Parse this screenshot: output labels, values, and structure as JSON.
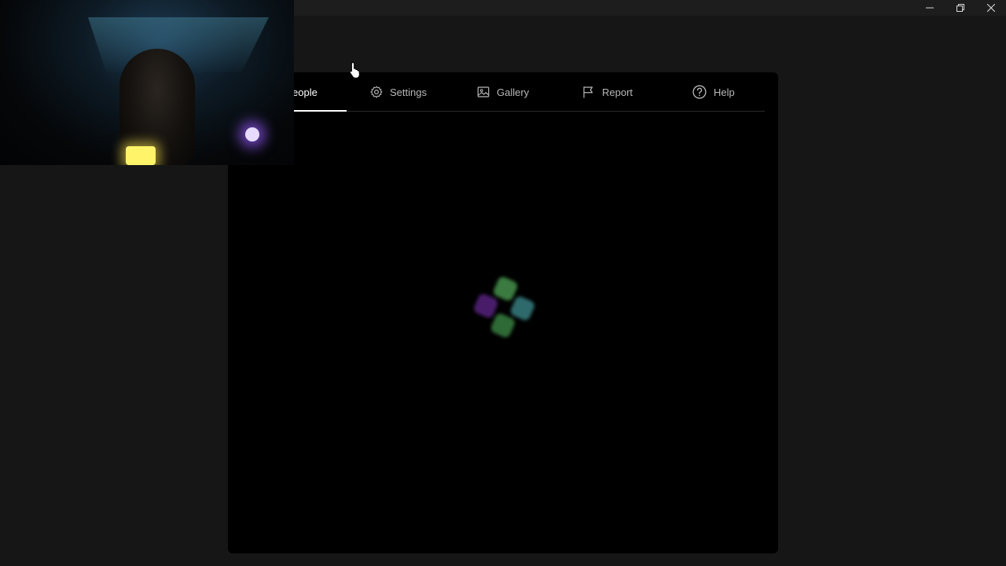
{
  "window_controls": {
    "minimize_label": "─",
    "restore_label": "❐",
    "close_label": "✕"
  },
  "tabs": [
    {
      "label": "People",
      "visible_label": "eople",
      "icon": "people-icon",
      "active": true
    },
    {
      "label": "Settings",
      "icon": "gear-icon",
      "active": false
    },
    {
      "label": "Gallery",
      "icon": "image-icon",
      "active": false
    },
    {
      "label": "Report",
      "icon": "flag-icon",
      "active": false
    },
    {
      "label": "Help",
      "icon": "help-circle-icon",
      "active": false
    }
  ],
  "colors": {
    "background": "#161616",
    "panel": "#000000",
    "tab_text": "#b8b8b8",
    "tab_active": "#ffffff",
    "loader_green": "#3b7a3f",
    "loader_teal": "#2f6a6c",
    "loader_purple": "#4a1a6a"
  },
  "overlays": {
    "webcam": "webcam-feed",
    "cursor": "hand-pointer-icon"
  }
}
